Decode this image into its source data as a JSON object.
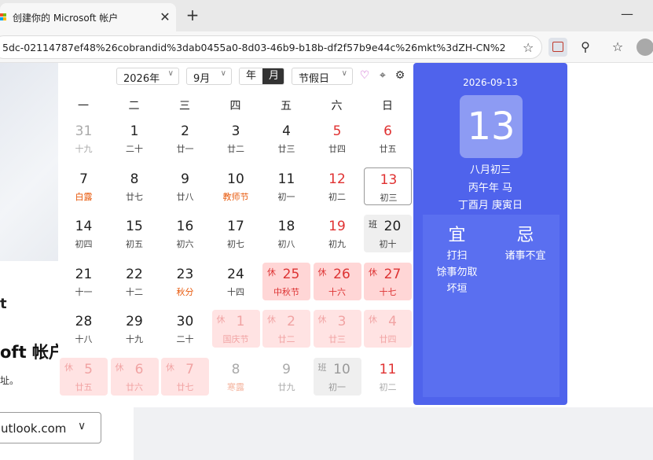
{
  "browser": {
    "tab_title": "创建你的 Microsoft 帐户",
    "tab_close": "✕",
    "new_tab": "+",
    "minimize": "—",
    "url": "5dc-02114787ef48%26cobrandid%3dab0455a0-8d03-46b9-b18b-df2f57b9e44c%26mkt%3dZH-CN%26...",
    "icons": [
      "favorite-star-icon",
      "calendar-extension-icon",
      "extensions-icon",
      "favorites-icon",
      "profile-avatar"
    ]
  },
  "background_page": {
    "heading_fragment": "t",
    "title_fragment": "oft 帐户",
    "subtitle_fragment": "址。",
    "domain_select_value": "utlook.com",
    "domain_select_caret": "∨"
  },
  "calendar": {
    "controls": {
      "year_value": "2026年",
      "month_value": "9月",
      "view_year": "年",
      "view_month": "月",
      "holiday_value": "节假日",
      "caret": "∨",
      "icons": {
        "heart": "♡",
        "locate": "⌖",
        "settings": "⚙"
      },
      "colors": {
        "heart": "#c548c8",
        "locate": "#333333",
        "settings": "#333333"
      }
    },
    "weekdays": [
      "一",
      "二",
      "三",
      "四",
      "五",
      "六",
      "日"
    ],
    "rows": [
      [
        {
          "d": "31",
          "l": "十九",
          "other": true
        },
        {
          "d": "1",
          "l": "二十"
        },
        {
          "d": "2",
          "l": "廿一"
        },
        {
          "d": "3",
          "l": "廿二"
        },
        {
          "d": "4",
          "l": "廿三"
        },
        {
          "d": "5",
          "l": "廿四",
          "red": true
        },
        {
          "d": "6",
          "l": "廿五",
          "red": true
        }
      ],
      [
        {
          "d": "7",
          "l": "白露",
          "festival": true
        },
        {
          "d": "8",
          "l": "廿七"
        },
        {
          "d": "9",
          "l": "廿八"
        },
        {
          "d": "10",
          "l": "教师节",
          "festival": true
        },
        {
          "d": "11",
          "l": "初一"
        },
        {
          "d": "12",
          "l": "初二",
          "red": true
        },
        {
          "d": "13",
          "l": "初三",
          "selected": true
        }
      ],
      [
        {
          "d": "14",
          "l": "初四"
        },
        {
          "d": "15",
          "l": "初五"
        },
        {
          "d": "16",
          "l": "初六"
        },
        {
          "d": "17",
          "l": "初七"
        },
        {
          "d": "18",
          "l": "初八"
        },
        {
          "d": "19",
          "l": "初九",
          "red": true
        },
        {
          "d": "20",
          "l": "初十",
          "workday": true,
          "tag": "班"
        }
      ],
      [
        {
          "d": "21",
          "l": "十一"
        },
        {
          "d": "22",
          "l": "十二"
        },
        {
          "d": "23",
          "l": "秋分",
          "festival": true
        },
        {
          "d": "24",
          "l": "十四"
        },
        {
          "d": "25",
          "l": "中秋节",
          "holiday": true,
          "tag": "休"
        },
        {
          "d": "26",
          "l": "十六",
          "holiday": true,
          "tag": "休"
        },
        {
          "d": "27",
          "l": "十七",
          "holiday": true,
          "tag": "休"
        }
      ],
      [
        {
          "d": "28",
          "l": "十八"
        },
        {
          "d": "29",
          "l": "十九"
        },
        {
          "d": "30",
          "l": "二十"
        },
        {
          "d": "1",
          "l": "国庆节",
          "holiday": true,
          "other": true,
          "tag": "休"
        },
        {
          "d": "2",
          "l": "廿二",
          "holiday": true,
          "other": true,
          "tag": "休"
        },
        {
          "d": "3",
          "l": "廿三",
          "holiday": true,
          "other": true,
          "tag": "休"
        },
        {
          "d": "4",
          "l": "廿四",
          "holiday": true,
          "other": true,
          "tag": "休"
        }
      ],
      [
        {
          "d": "5",
          "l": "廿五",
          "holiday": true,
          "other": true,
          "tag": "休"
        },
        {
          "d": "6",
          "l": "廿六",
          "holiday": true,
          "other": true,
          "tag": "休"
        },
        {
          "d": "7",
          "l": "廿七",
          "holiday": true,
          "other": true,
          "tag": "休"
        },
        {
          "d": "8",
          "l": "寒露",
          "other": true,
          "festival": true
        },
        {
          "d": "9",
          "l": "廿九",
          "other": true
        },
        {
          "d": "10",
          "l": "初一",
          "other": true,
          "workday": true,
          "tag": "班"
        },
        {
          "d": "11",
          "l": "初二",
          "other": true,
          "red": true
        }
      ]
    ]
  },
  "side_panel": {
    "date": "2026-09-13",
    "day": "13",
    "lunar": "八月初三",
    "ganzhi_year": "丙午年 马",
    "ganzhi_month_day": "丁酉月 庚寅日",
    "yi_label": "宜",
    "ji_label": "忌",
    "yi": [
      "打扫",
      "馀事勿取",
      "坏垣"
    ],
    "ji": [
      "诸事不宜"
    ],
    "color": "#4f63ec"
  }
}
